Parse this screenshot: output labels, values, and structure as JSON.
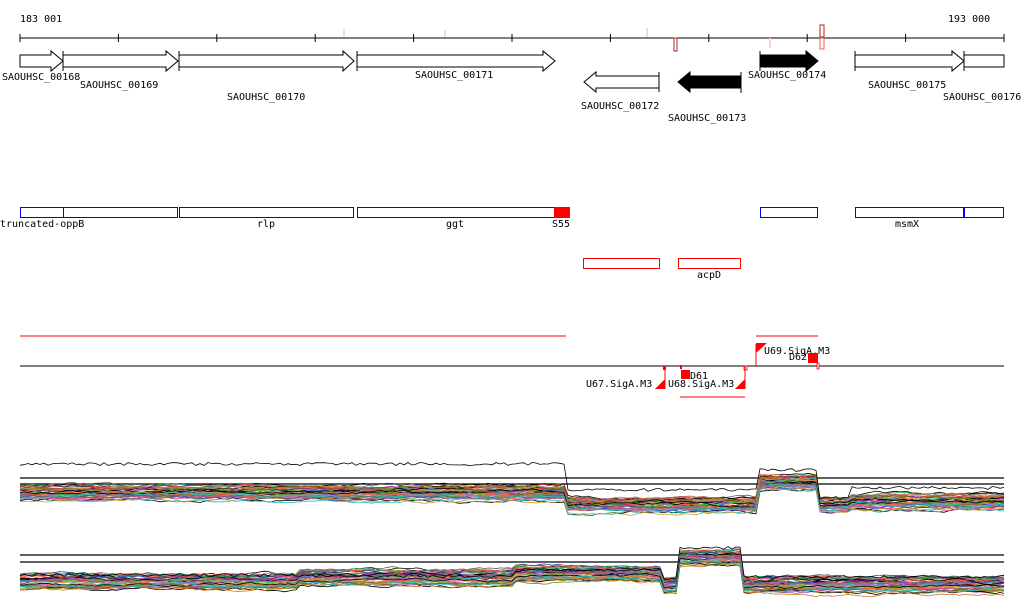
{
  "ruler": {
    "start_label": "183 001",
    "end_label": "193 000"
  },
  "genes": [
    {
      "id": "SAOUHSC_00168",
      "strand": "+",
      "filled": false
    },
    {
      "id": "SAOUHSC_00169",
      "strand": "+",
      "filled": false
    },
    {
      "id": "SAOUHSC_00170",
      "strand": "+",
      "filled": false
    },
    {
      "id": "SAOUHSC_00171",
      "strand": "+",
      "filled": false
    },
    {
      "id": "SAOUHSC_00172",
      "strand": "-",
      "filled": false
    },
    {
      "id": "SAOUHSC_00173",
      "strand": "-",
      "filled": true
    },
    {
      "id": "SAOUHSC_00174",
      "strand": "+",
      "filled": true
    },
    {
      "id": "SAOUHSC_00175",
      "strand": "+",
      "filled": false
    },
    {
      "id": "SAOUHSC_00176",
      "strand": "+",
      "filled": false
    }
  ],
  "features": {
    "blue": [
      "truncated-oppB",
      "rlp",
      "ggt",
      "msmX"
    ],
    "red_marker": "S55",
    "red_boxes": [
      "acpD"
    ]
  },
  "regulatory": {
    "labels": [
      "U69.SigA.M3",
      "D62",
      "D61",
      "U67.SigA.M3",
      "U68.SigA.M3"
    ]
  },
  "colors": {
    "feature_blue": "#0000ff",
    "feature_red": "#ff0000",
    "gene": "#000000"
  },
  "expression_palette": [
    "#e07020",
    "#50a0e0",
    "#a020a0",
    "#70c020",
    "#c04040",
    "#2040a0",
    "#d0a030",
    "#808000",
    "#ff6040",
    "#30a060",
    "#9060c0",
    "#c08060",
    "#e05090",
    "#606060",
    "#20c0c0"
  ]
}
